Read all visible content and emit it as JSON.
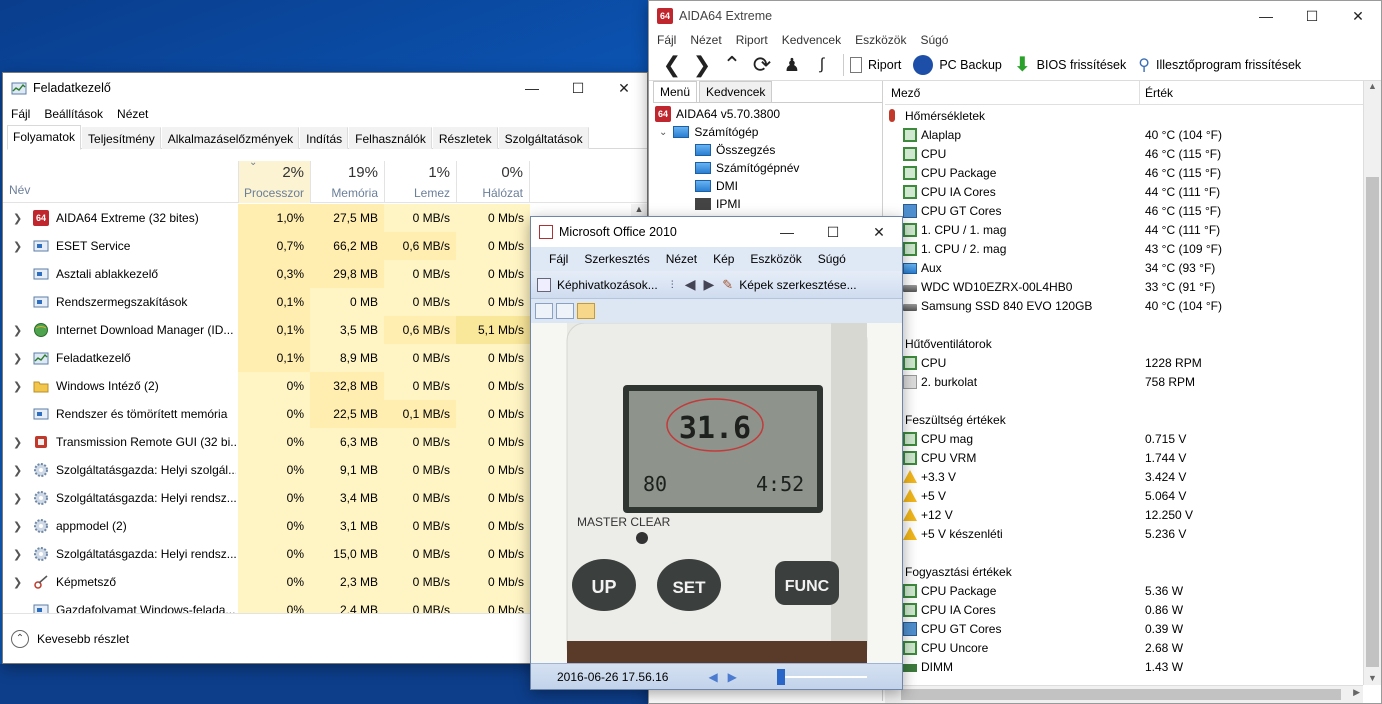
{
  "taskmgr": {
    "title": "Feladatkezelő",
    "menu": [
      "Fájl",
      "Beállítások",
      "Nézet"
    ],
    "tabs": [
      "Folyamatok",
      "Teljesítmény",
      "Alkalmazáselőzmények",
      "Indítás",
      "Felhasználók",
      "Részletek",
      "Szolgáltatások"
    ],
    "columns": {
      "name": "Név",
      "cpu_pct": "2%",
      "cpu_label": "Processzor",
      "mem_pct": "19%",
      "mem_label": "Memória",
      "disk_pct": "1%",
      "disk_label": "Lemez",
      "net_pct": "0%",
      "net_label": "Hálózat"
    },
    "rows": [
      {
        "name": "AIDA64 Extreme (32 bites)",
        "cpu": "1,0%",
        "mem": "27,5 MB",
        "disk": "0 MB/s",
        "net": "0 Mb/s",
        "icon": "aida64-icon",
        "expandable": true
      },
      {
        "name": "ESET Service",
        "cpu": "0,7%",
        "mem": "66,2 MB",
        "disk": "0,6 MB/s",
        "net": "0 Mb/s",
        "icon": "service-icon",
        "expandable": true
      },
      {
        "name": "Asztali ablakkezelő",
        "cpu": "0,3%",
        "mem": "29,8 MB",
        "disk": "0 MB/s",
        "net": "0 Mb/s",
        "icon": "service-icon",
        "expandable": false
      },
      {
        "name": "Rendszermegszakítások",
        "cpu": "0,1%",
        "mem": "0 MB",
        "disk": "0 MB/s",
        "net": "0 Mb/s",
        "icon": "service-icon",
        "expandable": false
      },
      {
        "name": "Internet Download Manager (ID...",
        "cpu": "0,1%",
        "mem": "3,5 MB",
        "disk": "0,6 MB/s",
        "net": "5,1 Mb/s",
        "icon": "globe-icon",
        "expandable": true
      },
      {
        "name": "Feladatkezelő",
        "cpu": "0,1%",
        "mem": "8,9 MB",
        "disk": "0 MB/s",
        "net": "0 Mb/s",
        "icon": "taskmgr-icon",
        "expandable": true
      },
      {
        "name": "Windows Intéző (2)",
        "cpu": "0%",
        "mem": "32,8 MB",
        "disk": "0 MB/s",
        "net": "0 Mb/s",
        "icon": "folder-icon",
        "expandable": true
      },
      {
        "name": "Rendszer és tömörített memória",
        "cpu": "0%",
        "mem": "22,5 MB",
        "disk": "0,1 MB/s",
        "net": "0 Mb/s",
        "icon": "service-icon",
        "expandable": false
      },
      {
        "name": "Transmission Remote GUI (32 bi...",
        "cpu": "0%",
        "mem": "6,3 MB",
        "disk": "0 MB/s",
        "net": "0 Mb/s",
        "icon": "transmission-icon",
        "expandable": true
      },
      {
        "name": "Szolgáltatásgazda: Helyi szolgál...",
        "cpu": "0%",
        "mem": "9,1 MB",
        "disk": "0 MB/s",
        "net": "0 Mb/s",
        "icon": "gear-icon",
        "expandable": true
      },
      {
        "name": "Szolgáltatásgazda: Helyi rendsz...",
        "cpu": "0%",
        "mem": "3,4 MB",
        "disk": "0 MB/s",
        "net": "0 Mb/s",
        "icon": "gear-icon",
        "expandable": true
      },
      {
        "name": "appmodel (2)",
        "cpu": "0%",
        "mem": "3,1 MB",
        "disk": "0 MB/s",
        "net": "0 Mb/s",
        "icon": "gear-icon",
        "expandable": true
      },
      {
        "name": "Szolgáltatásgazda: Helyi rendsz...",
        "cpu": "0%",
        "mem": "15,0 MB",
        "disk": "0 MB/s",
        "net": "0 Mb/s",
        "icon": "gear-icon",
        "expandable": true
      },
      {
        "name": "Képmetsző",
        "cpu": "0%",
        "mem": "2,3 MB",
        "disk": "0 MB/s",
        "net": "0 Mb/s",
        "icon": "scissors-icon",
        "expandable": true
      },
      {
        "name": "Gazdafolyamat Windows-felada...",
        "cpu": "0%",
        "mem": "2,4 MB",
        "disk": "0 MB/s",
        "net": "0 Mb/s",
        "icon": "service-icon",
        "expandable": false
      }
    ],
    "footer": "Kevesebb részlet"
  },
  "aida": {
    "title": "AIDA64 Extreme",
    "menu": [
      "Fájl",
      "Nézet",
      "Riport",
      "Kedvencek",
      "Eszközök",
      "Súgó"
    ],
    "toolbar": {
      "report": "Riport",
      "backup": "PC Backup",
      "bios": "BIOS frissítések",
      "driver": "Illesztőprogram frissítések"
    },
    "left_tabs": [
      "Menü",
      "Kedvencek"
    ],
    "tree": {
      "root": "AIDA64 v5.70.3800",
      "computer": "Számítógép",
      "children": [
        "Összegzés",
        "Számítógépnév",
        "DMI",
        "IPMI"
      ]
    },
    "headers": {
      "field": "Mező",
      "value": "Érték"
    },
    "sections": [
      {
        "title": "Hőmérsékletek",
        "items": [
          {
            "name": "Alaplap",
            "value": "40 °C  (104 °F)",
            "icon": "chip"
          },
          {
            "name": "CPU",
            "value": "46 °C  (115 °F)",
            "icon": "chip"
          },
          {
            "name": "CPU Package",
            "value": "46 °C  (115 °F)",
            "icon": "chip"
          },
          {
            "name": "CPU IA Cores",
            "value": "44 °C  (111 °F)",
            "icon": "chip"
          },
          {
            "name": "CPU GT Cores",
            "value": "46 °C  (115 °F)",
            "icon": "gpu"
          },
          {
            "name": "1. CPU / 1. mag",
            "value": "44 °C  (111 °F)",
            "icon": "chip"
          },
          {
            "name": "1. CPU / 2. mag",
            "value": "43 °C  (109 °F)",
            "icon": "chip"
          },
          {
            "name": "Aux",
            "value": "34 °C  (93 °F)",
            "icon": "monitor"
          },
          {
            "name": "WDC WD10EZRX-00L4HB0",
            "value": "33 °C  (91 °F)",
            "icon": "hdd"
          },
          {
            "name": "Samsung SSD 840 EVO 120GB",
            "value": "40 °C  (104 °F)",
            "icon": "hdd"
          }
        ]
      },
      {
        "title": "Hűtőventilátorok",
        "items": [
          {
            "name": "CPU",
            "value": "1228 RPM",
            "icon": "chip"
          },
          {
            "name": "2. burkolat",
            "value": "758 RPM",
            "icon": "case"
          }
        ]
      },
      {
        "title": "Feszültség értékek",
        "items": [
          {
            "name": "CPU mag",
            "value": "0.715 V",
            "icon": "chip"
          },
          {
            "name": "CPU VRM",
            "value": "1.744 V",
            "icon": "chip"
          },
          {
            "name": "+3.3 V",
            "value": "3.424 V",
            "icon": "warn"
          },
          {
            "name": "+5 V",
            "value": "5.064 V",
            "icon": "warn"
          },
          {
            "name": "+12 V",
            "value": "12.250 V",
            "icon": "warn"
          },
          {
            "name": "+5 V készenléti",
            "value": "5.236 V",
            "icon": "warn"
          }
        ]
      },
      {
        "title": "Fogyasztási értékek",
        "items": [
          {
            "name": "CPU Package",
            "value": "5.36 W",
            "icon": "chip"
          },
          {
            "name": "CPU IA Cores",
            "value": "0.86 W",
            "icon": "chip"
          },
          {
            "name": "CPU GT Cores",
            "value": "0.39 W",
            "icon": "gpu"
          },
          {
            "name": "CPU Uncore",
            "value": "2.68 W",
            "icon": "chip"
          },
          {
            "name": "DIMM",
            "value": "1.43 W",
            "icon": "ram"
          }
        ]
      }
    ]
  },
  "office": {
    "title": "Microsoft Office 2010",
    "menu": [
      "Fájl",
      "Szerkesztés",
      "Nézet",
      "Kép",
      "Eszközök",
      "Súgó"
    ],
    "tools": {
      "shortcuts": "Képhivatkozások...",
      "edit": "Képek szerkesztése..."
    },
    "photo": {
      "lcd_value": "31.6",
      "lcd_sub_left": "80",
      "lcd_sub_right": "4:52",
      "master_clear": "MASTER CLEAR",
      "btn_up": "UP",
      "btn_set": "SET",
      "btn_func": "FUNC"
    },
    "status_date": "2016-06-26 17.56.16"
  }
}
